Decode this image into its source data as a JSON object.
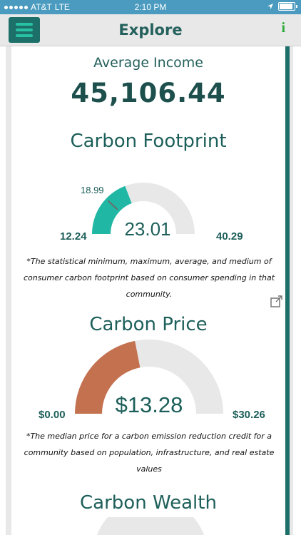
{
  "status_bar": {
    "carrier": "AT&T",
    "network": "LTE",
    "time": "2:10 PM"
  },
  "nav": {
    "title": "Explore",
    "info_label": "i"
  },
  "income": {
    "label": "Average Income",
    "value": "45,106.44"
  },
  "carbon_footprint": {
    "title": "Carbon Footprint",
    "min_label": "12.24",
    "max_label": "40.29",
    "marker_label": "18.99",
    "value_label": "23.01",
    "min": 12.24,
    "max": 40.29,
    "value": 23.01,
    "marker": 18.99,
    "fill_color": "#20b8a5",
    "footnote": "*The statistical minimum, maximum, average, and medium of consumer carbon footprint based on consumer spending in that community."
  },
  "carbon_price": {
    "title": "Carbon Price",
    "min_label": "$0.00",
    "max_label": "$30.26",
    "value_label": "$13.28",
    "min": 0,
    "max": 30.26,
    "value": 13.28,
    "fill_color": "#c4714f",
    "footnote": "*The median price for a carbon emission reduction credit for a community based on population, infrastructure, and real estate values"
  },
  "carbon_wealth": {
    "title": "Carbon Wealth"
  }
}
